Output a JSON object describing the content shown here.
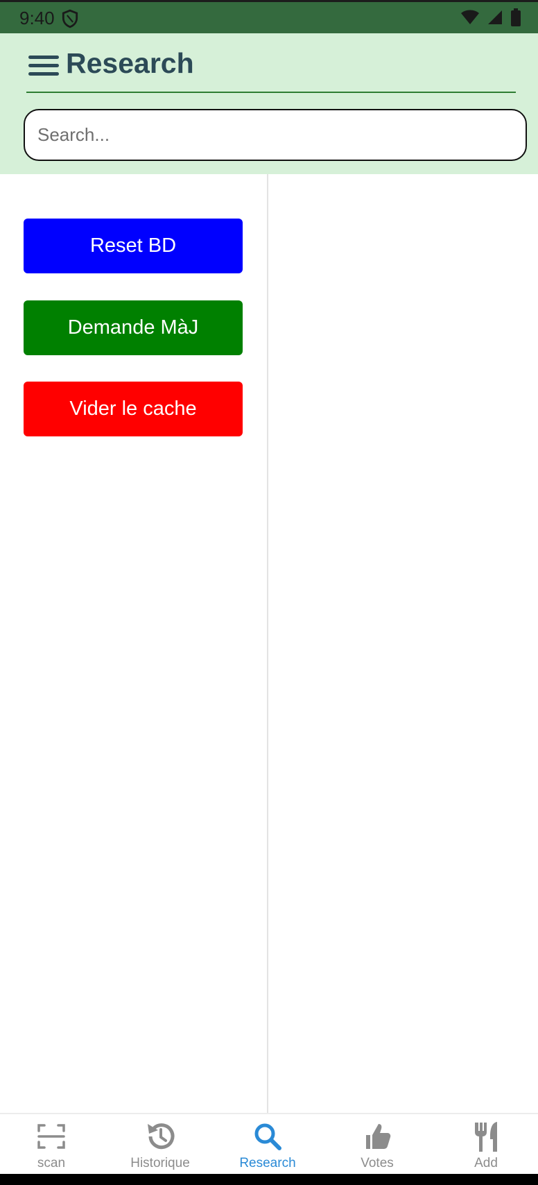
{
  "status_bar": {
    "time": "9:40"
  },
  "header": {
    "title": "Research",
    "search_placeholder": "Search..."
  },
  "actions": {
    "reset_label": "Reset BD",
    "update_label": "Demande MàJ",
    "cache_label": "Vider le cache"
  },
  "bottom_nav": {
    "items": [
      {
        "label": "scan",
        "icon": "scan-icon",
        "active": false
      },
      {
        "label": "Historique",
        "icon": "history-icon",
        "active": false
      },
      {
        "label": "Research",
        "icon": "search-icon",
        "active": true
      },
      {
        "label": "Votes",
        "icon": "thumbs-up-icon",
        "active": false
      },
      {
        "label": "Add",
        "icon": "fork-knife-icon",
        "active": false
      }
    ]
  },
  "colors": {
    "status_bar": "#346a3e",
    "header_bg": "#d6f0d8",
    "title_text": "#2c4a57",
    "reset_button": "#0000ff",
    "update_button": "#008000",
    "cache_button": "#ff0000",
    "nav_active": "#2a8ad6",
    "nav_inactive": "#8c8c8c"
  }
}
